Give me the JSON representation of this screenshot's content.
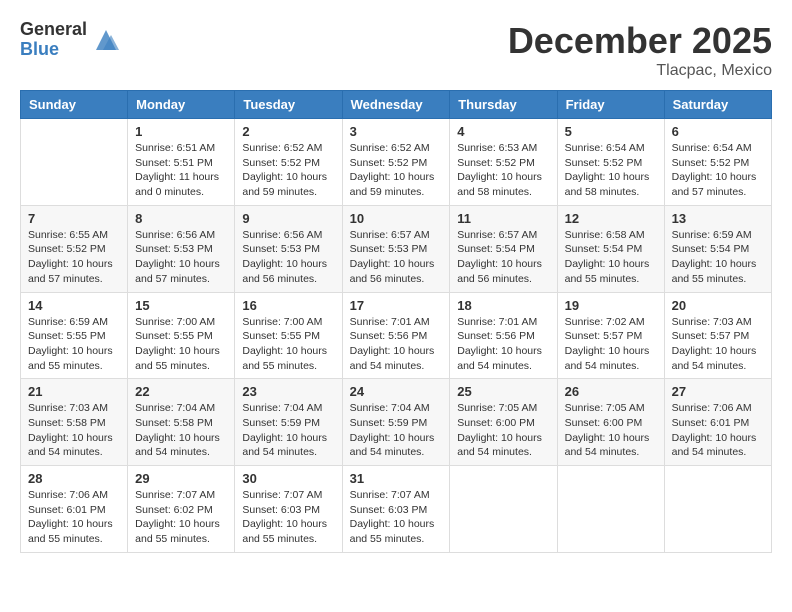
{
  "header": {
    "logo_general": "General",
    "logo_blue": "Blue",
    "month_title": "December 2025",
    "location": "Tlacpac, Mexico"
  },
  "weekdays": [
    "Sunday",
    "Monday",
    "Tuesday",
    "Wednesday",
    "Thursday",
    "Friday",
    "Saturday"
  ],
  "weeks": [
    [
      {
        "day": "",
        "sunrise": "",
        "sunset": "",
        "daylight": ""
      },
      {
        "day": "1",
        "sunrise": "Sunrise: 6:51 AM",
        "sunset": "Sunset: 5:51 PM",
        "daylight": "Daylight: 11 hours and 0 minutes."
      },
      {
        "day": "2",
        "sunrise": "Sunrise: 6:52 AM",
        "sunset": "Sunset: 5:52 PM",
        "daylight": "Daylight: 10 hours and 59 minutes."
      },
      {
        "day": "3",
        "sunrise": "Sunrise: 6:52 AM",
        "sunset": "Sunset: 5:52 PM",
        "daylight": "Daylight: 10 hours and 59 minutes."
      },
      {
        "day": "4",
        "sunrise": "Sunrise: 6:53 AM",
        "sunset": "Sunset: 5:52 PM",
        "daylight": "Daylight: 10 hours and 58 minutes."
      },
      {
        "day": "5",
        "sunrise": "Sunrise: 6:54 AM",
        "sunset": "Sunset: 5:52 PM",
        "daylight": "Daylight: 10 hours and 58 minutes."
      },
      {
        "day": "6",
        "sunrise": "Sunrise: 6:54 AM",
        "sunset": "Sunset: 5:52 PM",
        "daylight": "Daylight: 10 hours and 57 minutes."
      }
    ],
    [
      {
        "day": "7",
        "sunrise": "Sunrise: 6:55 AM",
        "sunset": "Sunset: 5:52 PM",
        "daylight": "Daylight: 10 hours and 57 minutes."
      },
      {
        "day": "8",
        "sunrise": "Sunrise: 6:56 AM",
        "sunset": "Sunset: 5:53 PM",
        "daylight": "Daylight: 10 hours and 57 minutes."
      },
      {
        "day": "9",
        "sunrise": "Sunrise: 6:56 AM",
        "sunset": "Sunset: 5:53 PM",
        "daylight": "Daylight: 10 hours and 56 minutes."
      },
      {
        "day": "10",
        "sunrise": "Sunrise: 6:57 AM",
        "sunset": "Sunset: 5:53 PM",
        "daylight": "Daylight: 10 hours and 56 minutes."
      },
      {
        "day": "11",
        "sunrise": "Sunrise: 6:57 AM",
        "sunset": "Sunset: 5:54 PM",
        "daylight": "Daylight: 10 hours and 56 minutes."
      },
      {
        "day": "12",
        "sunrise": "Sunrise: 6:58 AM",
        "sunset": "Sunset: 5:54 PM",
        "daylight": "Daylight: 10 hours and 55 minutes."
      },
      {
        "day": "13",
        "sunrise": "Sunrise: 6:59 AM",
        "sunset": "Sunset: 5:54 PM",
        "daylight": "Daylight: 10 hours and 55 minutes."
      }
    ],
    [
      {
        "day": "14",
        "sunrise": "Sunrise: 6:59 AM",
        "sunset": "Sunset: 5:55 PM",
        "daylight": "Daylight: 10 hours and 55 minutes."
      },
      {
        "day": "15",
        "sunrise": "Sunrise: 7:00 AM",
        "sunset": "Sunset: 5:55 PM",
        "daylight": "Daylight: 10 hours and 55 minutes."
      },
      {
        "day": "16",
        "sunrise": "Sunrise: 7:00 AM",
        "sunset": "Sunset: 5:55 PM",
        "daylight": "Daylight: 10 hours and 55 minutes."
      },
      {
        "day": "17",
        "sunrise": "Sunrise: 7:01 AM",
        "sunset": "Sunset: 5:56 PM",
        "daylight": "Daylight: 10 hours and 54 minutes."
      },
      {
        "day": "18",
        "sunrise": "Sunrise: 7:01 AM",
        "sunset": "Sunset: 5:56 PM",
        "daylight": "Daylight: 10 hours and 54 minutes."
      },
      {
        "day": "19",
        "sunrise": "Sunrise: 7:02 AM",
        "sunset": "Sunset: 5:57 PM",
        "daylight": "Daylight: 10 hours and 54 minutes."
      },
      {
        "day": "20",
        "sunrise": "Sunrise: 7:03 AM",
        "sunset": "Sunset: 5:57 PM",
        "daylight": "Daylight: 10 hours and 54 minutes."
      }
    ],
    [
      {
        "day": "21",
        "sunrise": "Sunrise: 7:03 AM",
        "sunset": "Sunset: 5:58 PM",
        "daylight": "Daylight: 10 hours and 54 minutes."
      },
      {
        "day": "22",
        "sunrise": "Sunrise: 7:04 AM",
        "sunset": "Sunset: 5:58 PM",
        "daylight": "Daylight: 10 hours and 54 minutes."
      },
      {
        "day": "23",
        "sunrise": "Sunrise: 7:04 AM",
        "sunset": "Sunset: 5:59 PM",
        "daylight": "Daylight: 10 hours and 54 minutes."
      },
      {
        "day": "24",
        "sunrise": "Sunrise: 7:04 AM",
        "sunset": "Sunset: 5:59 PM",
        "daylight": "Daylight: 10 hours and 54 minutes."
      },
      {
        "day": "25",
        "sunrise": "Sunrise: 7:05 AM",
        "sunset": "Sunset: 6:00 PM",
        "daylight": "Daylight: 10 hours and 54 minutes."
      },
      {
        "day": "26",
        "sunrise": "Sunrise: 7:05 AM",
        "sunset": "Sunset: 6:00 PM",
        "daylight": "Daylight: 10 hours and 54 minutes."
      },
      {
        "day": "27",
        "sunrise": "Sunrise: 7:06 AM",
        "sunset": "Sunset: 6:01 PM",
        "daylight": "Daylight: 10 hours and 54 minutes."
      }
    ],
    [
      {
        "day": "28",
        "sunrise": "Sunrise: 7:06 AM",
        "sunset": "Sunset: 6:01 PM",
        "daylight": "Daylight: 10 hours and 55 minutes."
      },
      {
        "day": "29",
        "sunrise": "Sunrise: 7:07 AM",
        "sunset": "Sunset: 6:02 PM",
        "daylight": "Daylight: 10 hours and 55 minutes."
      },
      {
        "day": "30",
        "sunrise": "Sunrise: 7:07 AM",
        "sunset": "Sunset: 6:03 PM",
        "daylight": "Daylight: 10 hours and 55 minutes."
      },
      {
        "day": "31",
        "sunrise": "Sunrise: 7:07 AM",
        "sunset": "Sunset: 6:03 PM",
        "daylight": "Daylight: 10 hours and 55 minutes."
      },
      {
        "day": "",
        "sunrise": "",
        "sunset": "",
        "daylight": ""
      },
      {
        "day": "",
        "sunrise": "",
        "sunset": "",
        "daylight": ""
      },
      {
        "day": "",
        "sunrise": "",
        "sunset": "",
        "daylight": ""
      }
    ]
  ]
}
